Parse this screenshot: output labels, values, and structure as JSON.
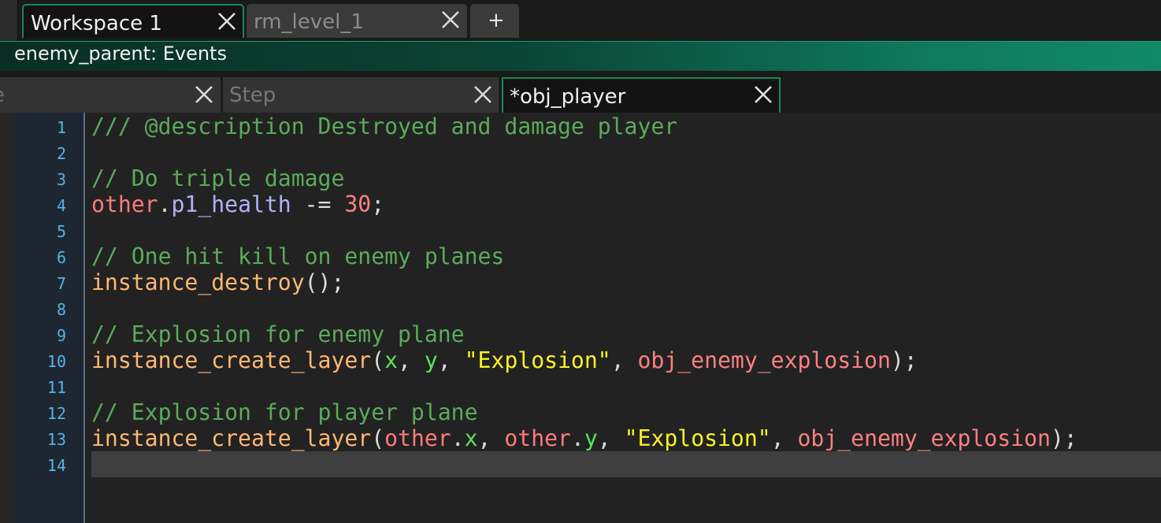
{
  "workspace_tabs": [
    {
      "label": "Workspace 1",
      "active": true
    },
    {
      "label": "rm_level_1",
      "active": false
    }
  ],
  "add_tab_label": "+",
  "header": {
    "title": "enemy_parent: Events"
  },
  "event_tabs": [
    {
      "label": "e",
      "active": false
    },
    {
      "label": "Step",
      "active": false
    },
    {
      "label": "*obj_player",
      "active": true
    }
  ],
  "editor": {
    "current_line": 14,
    "lines": [
      {
        "n": "1",
        "tokens": [
          {
            "t": "/// @description Destroyed and damage player",
            "k": "comment"
          }
        ]
      },
      {
        "n": "2",
        "tokens": []
      },
      {
        "n": "3",
        "tokens": [
          {
            "t": "// Do triple damage",
            "k": "comment"
          }
        ]
      },
      {
        "n": "4",
        "tokens": [
          {
            "t": "other",
            "k": "keyword"
          },
          {
            "t": ".",
            "k": "op"
          },
          {
            "t": "p1_health",
            "k": "var"
          },
          {
            "t": " -= ",
            "k": "op"
          },
          {
            "t": "30",
            "k": "num"
          },
          {
            "t": ";",
            "k": "op"
          }
        ]
      },
      {
        "n": "5",
        "tokens": []
      },
      {
        "n": "6",
        "tokens": [
          {
            "t": "// One hit kill on enemy planes",
            "k": "comment"
          }
        ]
      },
      {
        "n": "7",
        "tokens": [
          {
            "t": "instance_destroy",
            "k": "func"
          },
          {
            "t": "();",
            "k": "op"
          }
        ]
      },
      {
        "n": "8",
        "tokens": []
      },
      {
        "n": "9",
        "tokens": [
          {
            "t": "// Explosion for enemy plane",
            "k": "comment"
          }
        ]
      },
      {
        "n": "10",
        "tokens": [
          {
            "t": "instance_create_layer",
            "k": "func"
          },
          {
            "t": "(",
            "k": "op"
          },
          {
            "t": "x",
            "k": "builtin"
          },
          {
            "t": ", ",
            "k": "op"
          },
          {
            "t": "y",
            "k": "builtin"
          },
          {
            "t": ", ",
            "k": "op"
          },
          {
            "t": "\"Explosion\"",
            "k": "string"
          },
          {
            "t": ", ",
            "k": "op"
          },
          {
            "t": "obj_enemy_explosion",
            "k": "resource"
          },
          {
            "t": ");",
            "k": "op"
          }
        ]
      },
      {
        "n": "11",
        "tokens": []
      },
      {
        "n": "12",
        "tokens": [
          {
            "t": "// Explosion for player plane",
            "k": "comment"
          }
        ]
      },
      {
        "n": "13",
        "tokens": [
          {
            "t": "instance_create_layer",
            "k": "func"
          },
          {
            "t": "(",
            "k": "op"
          },
          {
            "t": "other",
            "k": "keyword"
          },
          {
            "t": ".",
            "k": "op"
          },
          {
            "t": "x",
            "k": "builtin"
          },
          {
            "t": ", ",
            "k": "op"
          },
          {
            "t": "other",
            "k": "keyword"
          },
          {
            "t": ".",
            "k": "op"
          },
          {
            "t": "y",
            "k": "builtin"
          },
          {
            "t": ", ",
            "k": "op"
          },
          {
            "t": "\"Explosion\"",
            "k": "string"
          },
          {
            "t": ", ",
            "k": "op"
          },
          {
            "t": "obj_enemy_explosion",
            "k": "resource"
          },
          {
            "t": ");",
            "k": "op"
          }
        ]
      },
      {
        "n": "14",
        "tokens": []
      }
    ]
  },
  "colors": {
    "accent": "#148a5a",
    "comment": "#5bab5b",
    "keyword": "#ff7b7b",
    "variable": "#b2b1ff",
    "function": "#ffb871",
    "builtin": "#58e55a",
    "string": "#fcf320",
    "number": "#ff8080",
    "line_number": "#56b3e8"
  }
}
